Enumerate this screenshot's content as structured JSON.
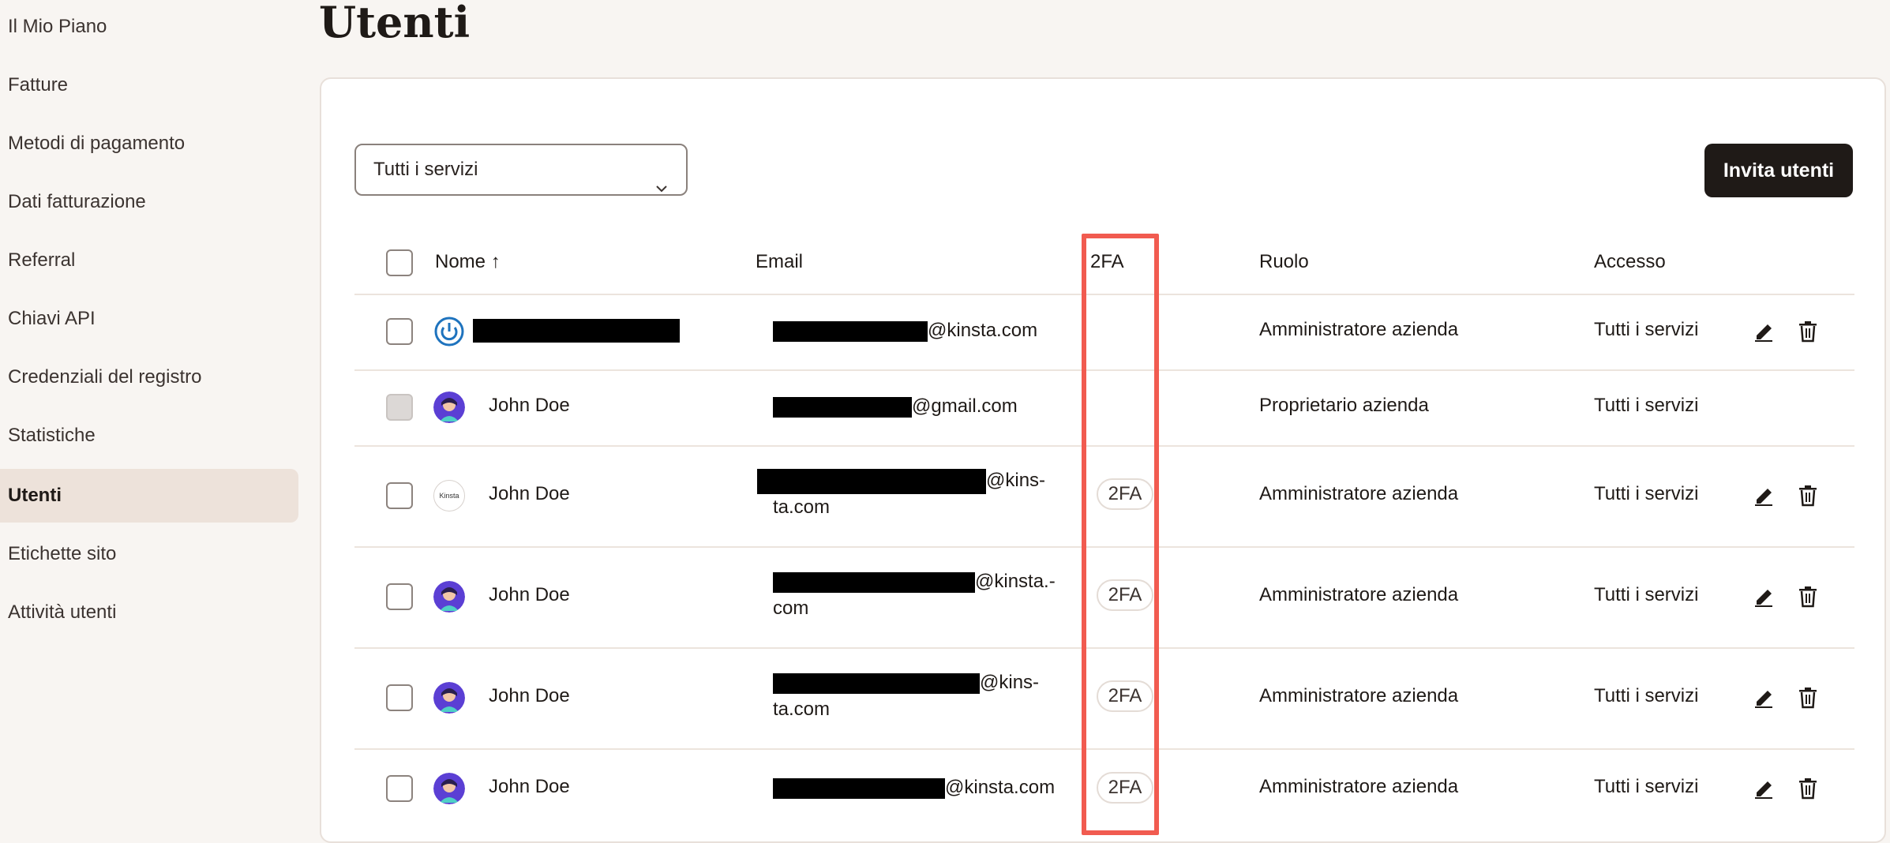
{
  "sidebar": {
    "items": [
      {
        "label": "Il Mio Piano"
      },
      {
        "label": "Fatture"
      },
      {
        "label": "Metodi di pagamento"
      },
      {
        "label": "Dati fatturazione"
      },
      {
        "label": "Referral"
      },
      {
        "label": "Chiavi API"
      },
      {
        "label": "Credenziali del registro"
      },
      {
        "label": "Statistiche"
      },
      {
        "label": "Utenti",
        "active": true
      },
      {
        "label": "Etichette sito"
      },
      {
        "label": "Attività utenti"
      }
    ]
  },
  "page": {
    "title": "Utenti"
  },
  "toolbar": {
    "filter_value": "Tutti i servizi",
    "invite_label": "Invita utenti"
  },
  "table": {
    "headers": {
      "name": "Nome ↑",
      "email": "Email",
      "twofa": "2FA",
      "role": "Ruolo",
      "access": "Accesso"
    },
    "rows": [
      {
        "name": "",
        "email_domain": "@kinsta.com",
        "email_domain2": "",
        "twofa": "",
        "role": "Amministratore azienda",
        "access": "Tutti i servizi"
      },
      {
        "name": "John Doe",
        "email_domain": "@gmail.com",
        "email_domain2": "",
        "twofa": "",
        "role": "Proprietario azienda",
        "access": "Tutti i servizi"
      },
      {
        "name": "John Doe",
        "email_domain": "@kins-",
        "email_domain2": "ta.com",
        "twofa": "2FA",
        "role": "Amministratore azienda",
        "access": "Tutti i servizi"
      },
      {
        "name": "John Doe",
        "email_domain": "@kinsta.-",
        "email_domain2": "com",
        "twofa": "2FA",
        "role": "Amministratore azienda",
        "access": "Tutti i servizi"
      },
      {
        "name": "John Doe",
        "email_domain": "@kins-",
        "email_domain2": "ta.com",
        "twofa": "2FA",
        "role": "Amministratore azienda",
        "access": "Tutti i servizi"
      },
      {
        "name": "John Doe",
        "email_domain": "@kinsta.com",
        "email_domain2": "",
        "twofa": "2FA",
        "role": "Amministratore azienda",
        "access": "Tutti i servizi"
      }
    ]
  },
  "avatar_brand_text": "Kinsta",
  "colors": {
    "highlight": "#f15b50",
    "accent": "#1f1a17",
    "active_sidebar": "#ede2da"
  }
}
